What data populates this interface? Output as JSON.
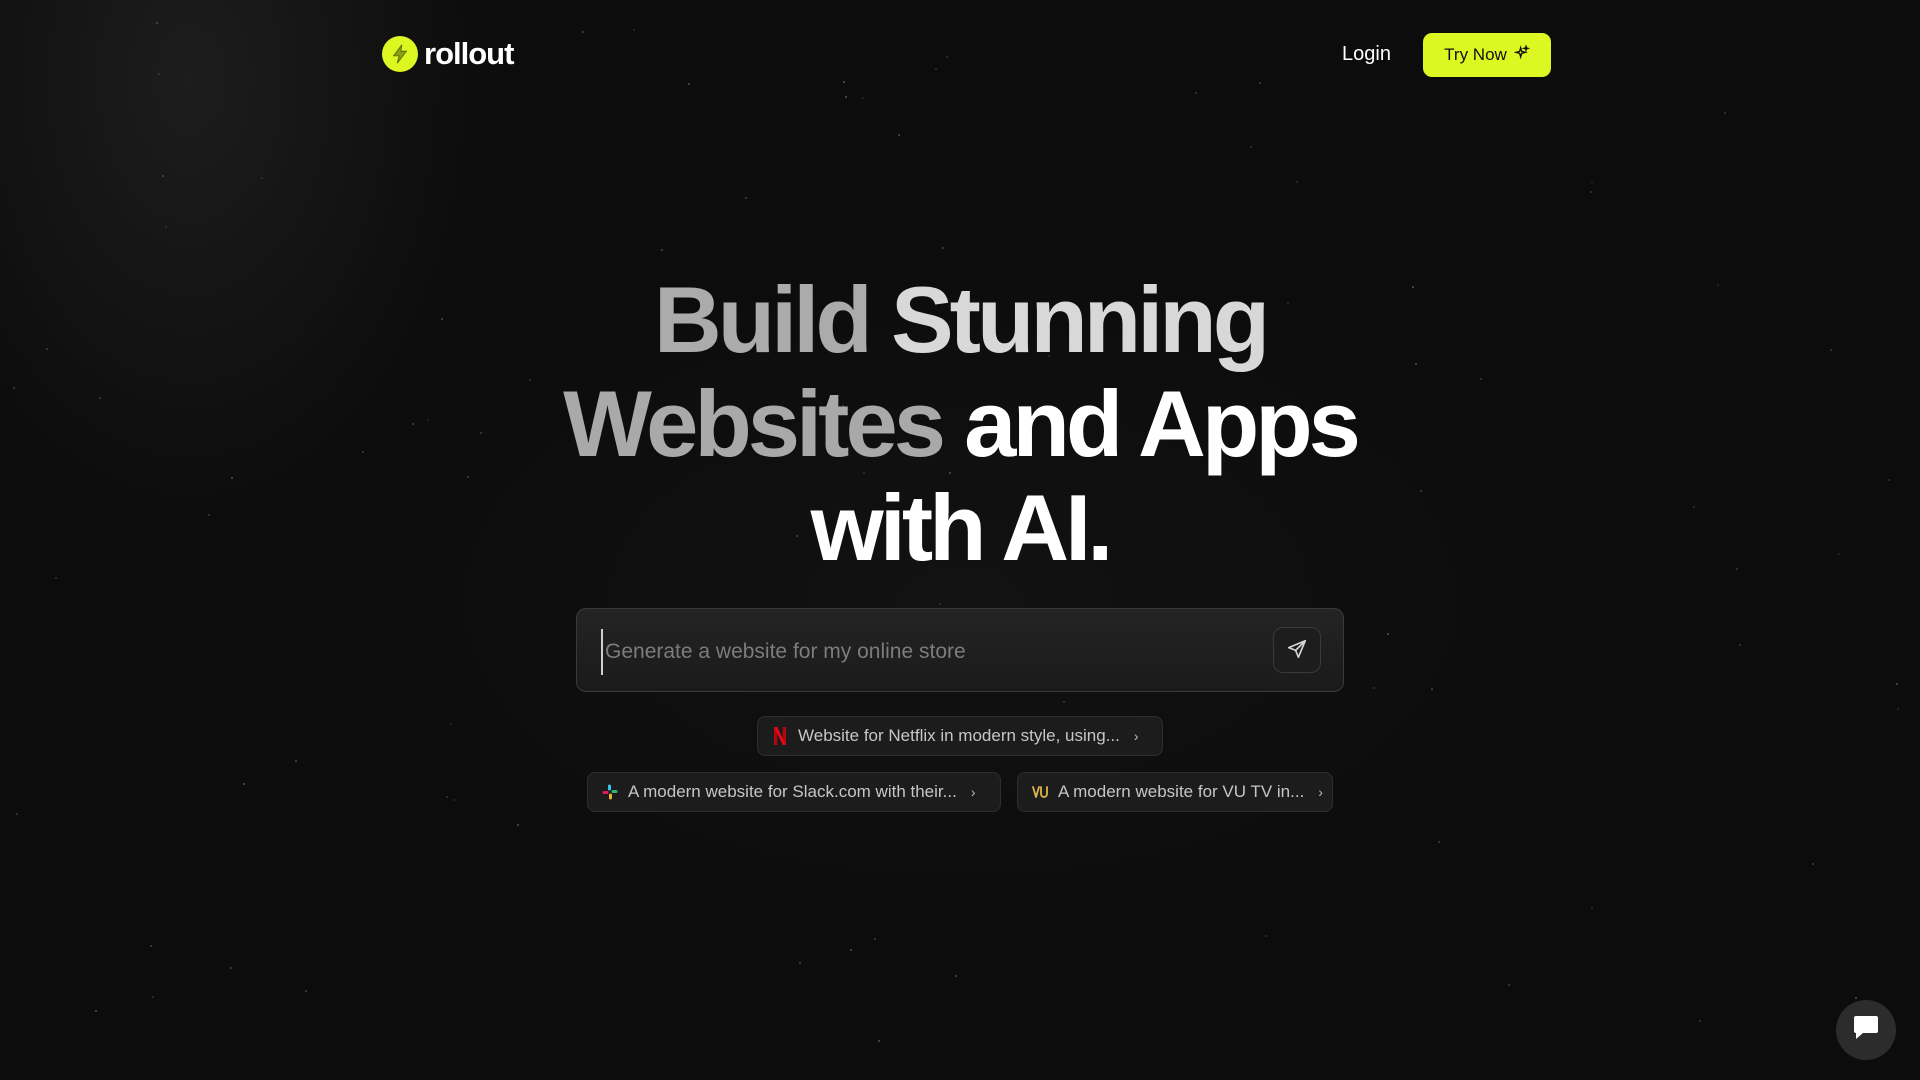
{
  "header": {
    "logo_text": "rollout",
    "login_label": "Login",
    "try_now_label": "Try Now"
  },
  "hero": {
    "line1": [
      "Build",
      "Stunning"
    ],
    "line2": [
      "Websites",
      "and",
      "Apps"
    ],
    "line3": "with AI."
  },
  "prompt": {
    "placeholder": "Generate a website for my online store",
    "value": ""
  },
  "suggestions": [
    {
      "icon": "netflix-logo-icon",
      "label": "Website for Netflix in modern style, using..."
    },
    {
      "icon": "slack-logo-icon",
      "label": "A modern website for Slack.com with their..."
    },
    {
      "icon": "vu-tv-logo-icon",
      "label": "A modern website for VU TV in..."
    }
  ],
  "colors": {
    "accent": "#dcf722",
    "background": "#0c0c0c",
    "netflix_red": "#e50914"
  },
  "icons": {
    "logo": "lightning-bolt-icon",
    "try_now": "sparkles-icon",
    "send": "send-arrow-icon",
    "chip_arrow": "chevron-right-icon",
    "chat": "chat-bubble-icon"
  }
}
